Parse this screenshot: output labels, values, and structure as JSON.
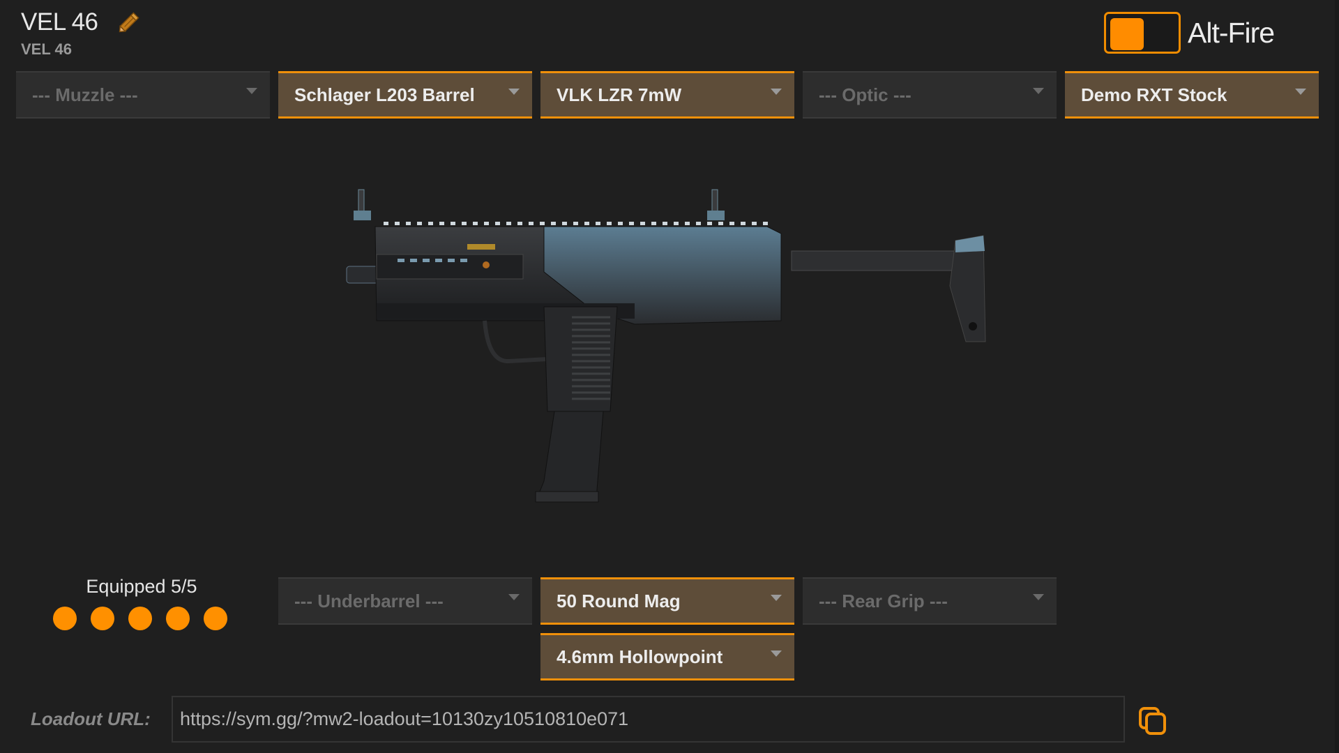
{
  "header": {
    "title": "VEL 46",
    "subtitle": "VEL 46",
    "edit_icon": "pencil-icon"
  },
  "alt_fire": {
    "label": "Alt-Fire",
    "enabled": false
  },
  "attachments_top": [
    {
      "slot": "muzzle",
      "label": "--- Muzzle ---",
      "selected": false
    },
    {
      "slot": "barrel",
      "label": "Schlager L203 Barrel",
      "selected": true
    },
    {
      "slot": "laser",
      "label": "VLK LZR 7mW",
      "selected": true
    },
    {
      "slot": "optic",
      "label": "--- Optic ---",
      "selected": false
    },
    {
      "slot": "stock",
      "label": "Demo RXT Stock",
      "selected": true
    }
  ],
  "attachments_bottom": [
    {
      "slot": "underbarrel",
      "label": "--- Underbarrel ---",
      "selected": false
    },
    {
      "slot": "magazine",
      "label": "50 Round Mag",
      "selected": true
    },
    {
      "slot": "rear-grip",
      "label": "--- Rear Grip ---",
      "selected": false
    },
    {
      "slot": "ammunition",
      "label": "4.6mm Hollowpoint",
      "selected": true
    }
  ],
  "equipped": {
    "label": "Equipped 5/5",
    "count": 5,
    "max": 5
  },
  "loadout": {
    "label": "Loadout URL:",
    "url": "https://sym.gg/?mw2-loadout=10130zy10510810e071",
    "copy_icon": "copy-icon"
  },
  "colors": {
    "accent": "#ff9000",
    "selected_bg": "#5e4d39",
    "empty_bg": "#2d2d2d",
    "page_bg": "#1f1f1f"
  }
}
